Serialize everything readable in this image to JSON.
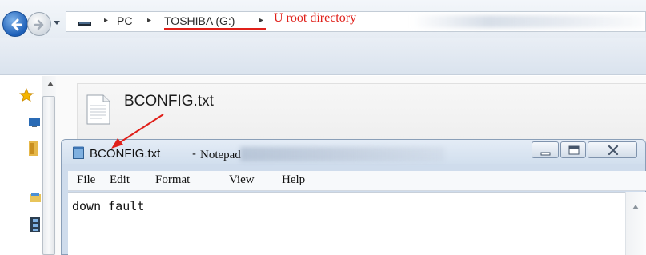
{
  "address_bar": {
    "breadcrumbs": [
      "PC",
      "TOSHIBA (G:)"
    ],
    "annotation": "U root directory"
  },
  "content": {
    "file_name": "BCONFIG.txt"
  },
  "notepad": {
    "title_file": "BCONFIG.txt",
    "title_separator": "-",
    "title_app": "Notepad",
    "menu": [
      "File",
      "Edit",
      "Format",
      "View",
      "Help"
    ],
    "text": "down_fault"
  },
  "colors": {
    "annotation_red": "#e0201a",
    "window_frame": "#cfdcec",
    "nav_blue": "#1c5fb8"
  }
}
